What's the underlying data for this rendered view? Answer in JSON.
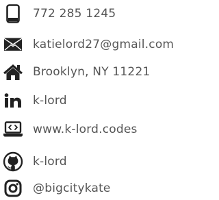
{
  "contacts": [
    {
      "type": "phone",
      "icon": "mobile-phone-icon",
      "text": "772 285 1245"
    },
    {
      "type": "email",
      "icon": "envelope-icon",
      "text": "katielord27@gmail.com"
    },
    {
      "type": "address",
      "icon": "home-icon",
      "text": "Brooklyn, NY 11221"
    },
    {
      "type": "linkedin",
      "icon": "linkedin-icon",
      "text": "k-lord"
    },
    {
      "type": "website",
      "icon": "laptop-code-icon",
      "text": "www.k-lord.codes"
    },
    {
      "type": "github",
      "icon": "github-icon",
      "text": "k-lord"
    },
    {
      "type": "instagram",
      "icon": "instagram-icon",
      "text": "@bigcitykate"
    }
  ],
  "colors": {
    "icon": "#222222",
    "text": "#555555",
    "background": "#ffffff"
  }
}
